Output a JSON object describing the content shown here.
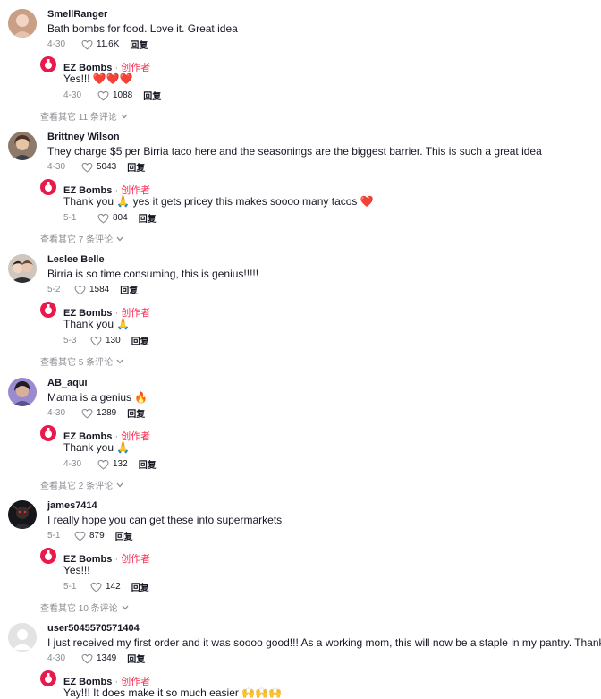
{
  "view_more_suffix_label": "",
  "comments": [
    {
      "user": "SmellRanger",
      "text": "Bath bombs for food. Love it. Great idea",
      "date": "4-30",
      "likes": "11.6K",
      "reply_label": "回复",
      "reply": {
        "user": "EZ Bombs",
        "tag": "创作者",
        "text": "Yes!!! ❤️❤️❤️",
        "date": "4-30",
        "likes": "1088",
        "reply_label": "回复"
      },
      "view_more": "查看其它 11 条评论"
    },
    {
      "user": "Brittney Wilson",
      "text": "They charge $5 per Birria taco here and the seasonings are the biggest barrier. This is such a great idea",
      "date": "4-30",
      "likes": "5043",
      "reply_label": "回复",
      "reply": {
        "user": "EZ Bombs",
        "tag": "创作者",
        "text": "Thank you 🙏 yes it gets pricey this makes soooo many tacos ❤️",
        "date": "5-1",
        "likes": "804",
        "reply_label": "回复"
      },
      "view_more": "查看其它 7 条评论"
    },
    {
      "user": "Leslee Belle",
      "text": "Birria is so time consuming, this is genius!!!!!",
      "date": "5-2",
      "likes": "1584",
      "reply_label": "回复",
      "reply": {
        "user": "EZ Bombs",
        "tag": "创作者",
        "text": "Thank you 🙏",
        "date": "5-3",
        "likes": "130",
        "reply_label": "回复"
      },
      "view_more": "查看其它 5 条评论"
    },
    {
      "user": "AB_aqui",
      "text": "Mama is a genius 🔥",
      "date": "4-30",
      "likes": "1289",
      "reply_label": "回复",
      "reply": {
        "user": "EZ Bombs",
        "tag": "创作者",
        "text": "Thank you 🙏",
        "date": "4-30",
        "likes": "132",
        "reply_label": "回复"
      },
      "view_more": "查看其它 2 条评论"
    },
    {
      "user": "james7414",
      "text": "I really hope you can get these into supermarkets",
      "date": "5-1",
      "likes": "879",
      "reply_label": "回复",
      "reply": {
        "user": "EZ Bombs",
        "tag": "创作者",
        "text": "Yes!!!",
        "date": "5-1",
        "likes": "142",
        "reply_label": "回复"
      },
      "view_more": "查看其它 10 条评论"
    },
    {
      "user": "user5045570571404",
      "text": "I just received my first order and it was soooo good!!! As a working mom, this will now be a staple in my pantry. Thank you!!",
      "date": "4-30",
      "likes": "1349",
      "reply_label": "回复",
      "reply": {
        "user": "EZ Bombs",
        "tag": "创作者",
        "text": "Yay!!! It does make it so much easier 🙌🙌🙌",
        "date": "",
        "likes": "",
        "reply_label": ""
      },
      "view_more": ""
    }
  ],
  "colors": {
    "accent": "#fe2c55",
    "muted": "#8a8b91",
    "text": "#161823"
  },
  "icons": {
    "like": "heart-outline-icon",
    "expand": "chevron-down-icon",
    "creator_avatar": "ez-bombs-logo-icon"
  }
}
